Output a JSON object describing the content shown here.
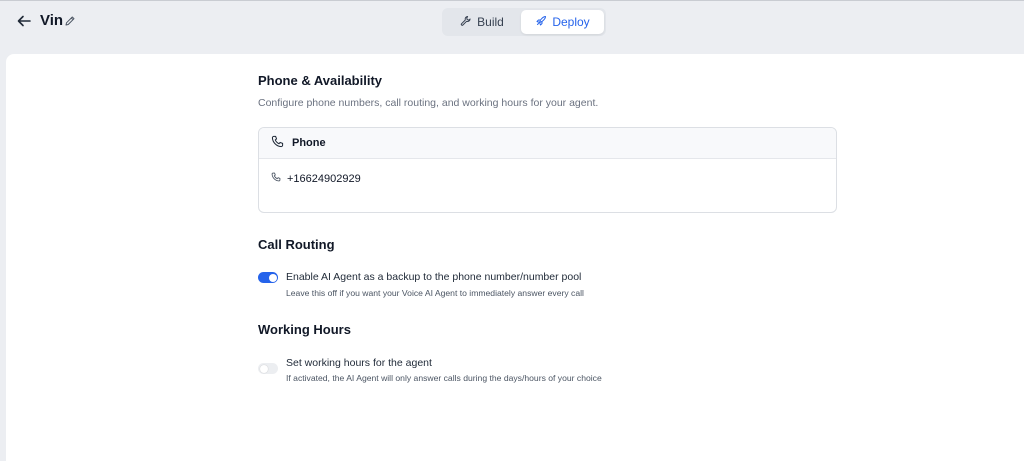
{
  "header": {
    "agent_name": "Vin",
    "tabs": [
      {
        "label": "Build",
        "icon": "wrench-icon",
        "active": false
      },
      {
        "label": "Deploy",
        "icon": "rocket-icon",
        "active": true
      }
    ]
  },
  "phone_section": {
    "title": "Phone & Availability",
    "subtitle": "Configure phone numbers, call routing, and working hours for your agent.",
    "card_title": "Phone",
    "phone_number": "+16624902929"
  },
  "call_routing": {
    "title": "Call Routing",
    "toggle_enabled": true,
    "label": "Enable AI Agent as a backup to the phone number/number pool",
    "hint": "Leave this off if you want your Voice AI Agent to immediately answer every call"
  },
  "working_hours": {
    "title": "Working Hours",
    "toggle_enabled": false,
    "label": "Set working hours for the agent",
    "hint": "If activated, the AI Agent will only answer calls during the days/hours of your choice"
  },
  "colors": {
    "accent": "#2563eb",
    "background": "#eceef2",
    "panel": "#ffffff"
  }
}
